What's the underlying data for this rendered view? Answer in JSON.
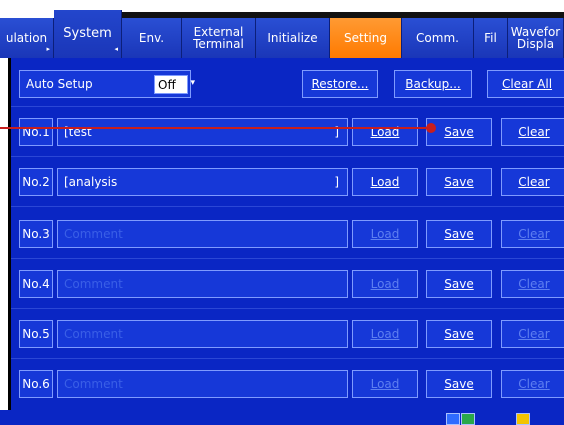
{
  "tabs": [
    {
      "label": "ulation",
      "marker": "▸"
    },
    {
      "label": "System",
      "marker": "◂"
    },
    {
      "label": "Env.",
      "marker": ""
    },
    {
      "label": "External Terminal",
      "label_line1": "External",
      "label_line2": "Terminal"
    },
    {
      "label": "Initialize"
    },
    {
      "label": "Setting"
    },
    {
      "label": "Comm."
    },
    {
      "label": "Fil"
    },
    {
      "label_line1": "Wavefor",
      "label_line2": "Displa"
    }
  ],
  "toolbar": {
    "auto_setup_label": "Auto Setup",
    "auto_setup_value": "Off",
    "restore_label": "Restore...",
    "backup_label": "Backup...",
    "clear_all_label": "Clear All"
  },
  "rows": [
    {
      "num": "No.1",
      "comment": "[test",
      "bracket": "]",
      "load": "Load",
      "save": "Save",
      "clear": "Clear"
    },
    {
      "num": "No.2",
      "comment": "[analysis",
      "bracket": "]",
      "load": "Load",
      "save": "Save",
      "clear": "Clear"
    },
    {
      "num": "No.3",
      "comment": "Comment",
      "bracket": "",
      "load": "Load",
      "save": "Save",
      "clear": "Clear"
    },
    {
      "num": "No.4",
      "comment": "Comment",
      "bracket": "",
      "load": "Load",
      "save": "Save",
      "clear": "Clear"
    },
    {
      "num": "No.5",
      "comment": "Comment",
      "bracket": "",
      "load": "Load",
      "save": "Save",
      "clear": "Clear"
    },
    {
      "num": "No.6",
      "comment": "Comment",
      "bracket": "",
      "load": "Load",
      "save": "Save",
      "clear": "Clear"
    }
  ],
  "colors": {
    "panel": "#0a26c4",
    "active_tab": "#ff8a1a",
    "callout": "#c81e1e"
  }
}
